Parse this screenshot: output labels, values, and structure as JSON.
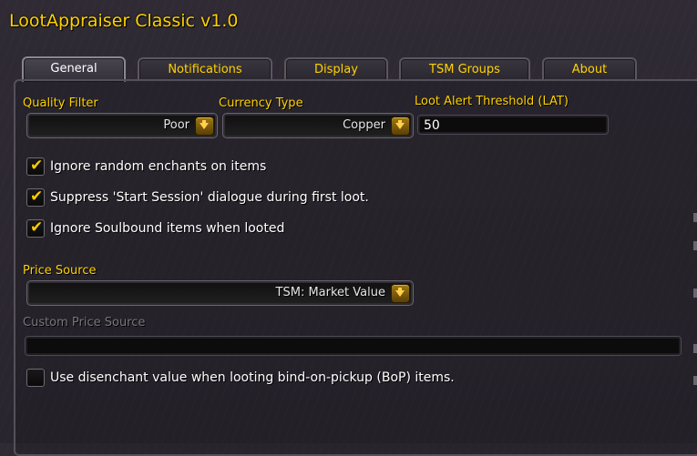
{
  "window": {
    "title": "LootAppraiser Classic v1.0"
  },
  "tabs": [
    {
      "label": "General",
      "active": true
    },
    {
      "label": "Notifications",
      "active": false
    },
    {
      "label": "Display",
      "active": false
    },
    {
      "label": "TSM Groups",
      "active": false
    },
    {
      "label": "About",
      "active": false
    }
  ],
  "general": {
    "quality_filter": {
      "label": "Quality Filter",
      "value": "Poor"
    },
    "currency_type": {
      "label": "Currency Type",
      "value": "Copper"
    },
    "lat": {
      "label": "Loot Alert Threshold (LAT)",
      "value": "50"
    },
    "checkboxes": [
      {
        "label": "Ignore random enchants on items",
        "checked": true
      },
      {
        "label": "Suppress 'Start Session' dialogue during first loot.",
        "checked": true
      },
      {
        "label": "Ignore Soulbound items when looted",
        "checked": true
      }
    ],
    "price_source": {
      "label": "Price Source",
      "value": "TSM: Market Value"
    },
    "custom_price_source": {
      "label": "Custom Price Source",
      "value": ""
    },
    "disenchant": {
      "label": "Use disenchant value when looting bind-on-pickup (BoP) items.",
      "checked": false
    }
  },
  "colors": {
    "accent": "#ffd200",
    "text": "#ffffff",
    "disabled": "#7a767c"
  },
  "icons": {
    "check": "✔"
  }
}
